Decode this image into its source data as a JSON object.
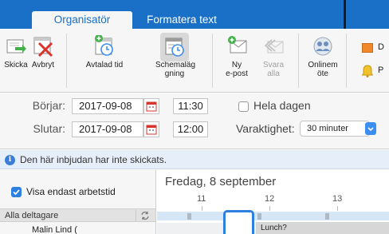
{
  "tabs": [
    {
      "label": "Organisatör",
      "active": true
    },
    {
      "label": "Formatera text",
      "active": false
    }
  ],
  "ribbon": {
    "buttons": [
      {
        "label": "Skicka",
        "icon": "send-icon"
      },
      {
        "label": "Avbryt",
        "icon": "cancel-icon"
      },
      {
        "label": "Avtalad tid",
        "icon": "appointment-icon"
      },
      {
        "label": "Schemaläggning",
        "label_lines": [
          "Schemaläg",
          "gning"
        ],
        "icon": "scheduling-icon",
        "selected": true
      },
      {
        "label": "Ny e-post",
        "label_lines": [
          "Ny",
          "e-post"
        ],
        "icon": "new-email-icon"
      },
      {
        "label": "Svara alla",
        "label_lines": [
          "Svara",
          "alla"
        ],
        "icon": "reply-all-icon",
        "disabled": true
      },
      {
        "label": "Onlinemöte",
        "label_lines": [
          "Onlinem",
          "öte"
        ],
        "icon": "online-meeting-icon"
      },
      {
        "label": "D",
        "icon": "category-icon"
      },
      {
        "label": "P",
        "icon": "bell-icon"
      }
    ]
  },
  "fields": {
    "start_label": "Börjar:",
    "start_date": "2017-09-08",
    "start_time": "11:30",
    "end_label": "Slutar:",
    "end_date": "2017-09-08",
    "end_time": "12:00",
    "all_day_label": "Hela dagen",
    "duration_label": "Varaktighet:",
    "duration_value": "30 minuter"
  },
  "info": {
    "message": "Den här inbjudan har inte skickats."
  },
  "scheduling": {
    "work_hours_label": "Visa endast arbetstid",
    "attendees_header": "Alla deltagare",
    "attendee_name": "Malin Lind (",
    "day_title": "Fredag, 8 september",
    "hours": [
      "11",
      "12",
      "13"
    ],
    "busy_label": "Lunch?"
  },
  "colors": {
    "accent": "#1a6fc6",
    "tab_bg": "#f6f6f6",
    "info_bg": "#e6eff9",
    "selection": "#2d7fe0",
    "busy": "#d7d7d7"
  }
}
